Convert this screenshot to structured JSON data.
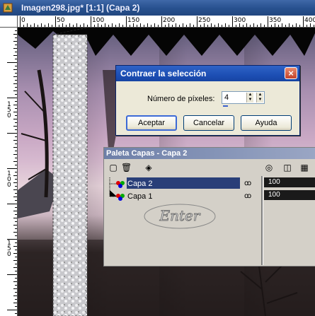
{
  "window": {
    "title": "Imagen298.jpg* [1:1] (Capa 2)",
    "icon": "paint-shop-pro-icon"
  },
  "rulers": {
    "top_labels": [
      "0",
      "50",
      "100",
      "150",
      "200",
      "250",
      "300",
      "350",
      "400"
    ],
    "left_labels": [
      "1",
      "5",
      "0",
      "1",
      "0",
      "0",
      "1",
      "5",
      "0"
    ]
  },
  "dialog": {
    "title": "Contraer la selección",
    "close_label": "×",
    "field_label": "Número de píxeles:",
    "field_value": "4",
    "buttons": {
      "ok": "Aceptar",
      "cancel": "Cancelar",
      "help": "Ayuda"
    }
  },
  "layers_palette": {
    "title": "Paleta Capas - Capa 2",
    "toolbar_icons": [
      "new-layer-icon",
      "delete-layer-icon",
      "mask-icon",
      "view-icon",
      "visibility-icon",
      "blend-icon"
    ],
    "layers": [
      {
        "name": "Capa 2",
        "selected": true,
        "visibility": "ꝏ",
        "opacity": "100"
      },
      {
        "name": "Capa 1",
        "selected": false,
        "visibility": "ꝏ",
        "opacity": "100"
      }
    ]
  },
  "watermark": {
    "text": "Enter"
  },
  "colors": {
    "accent": "#2f63c7",
    "selection": "#0a246a"
  }
}
